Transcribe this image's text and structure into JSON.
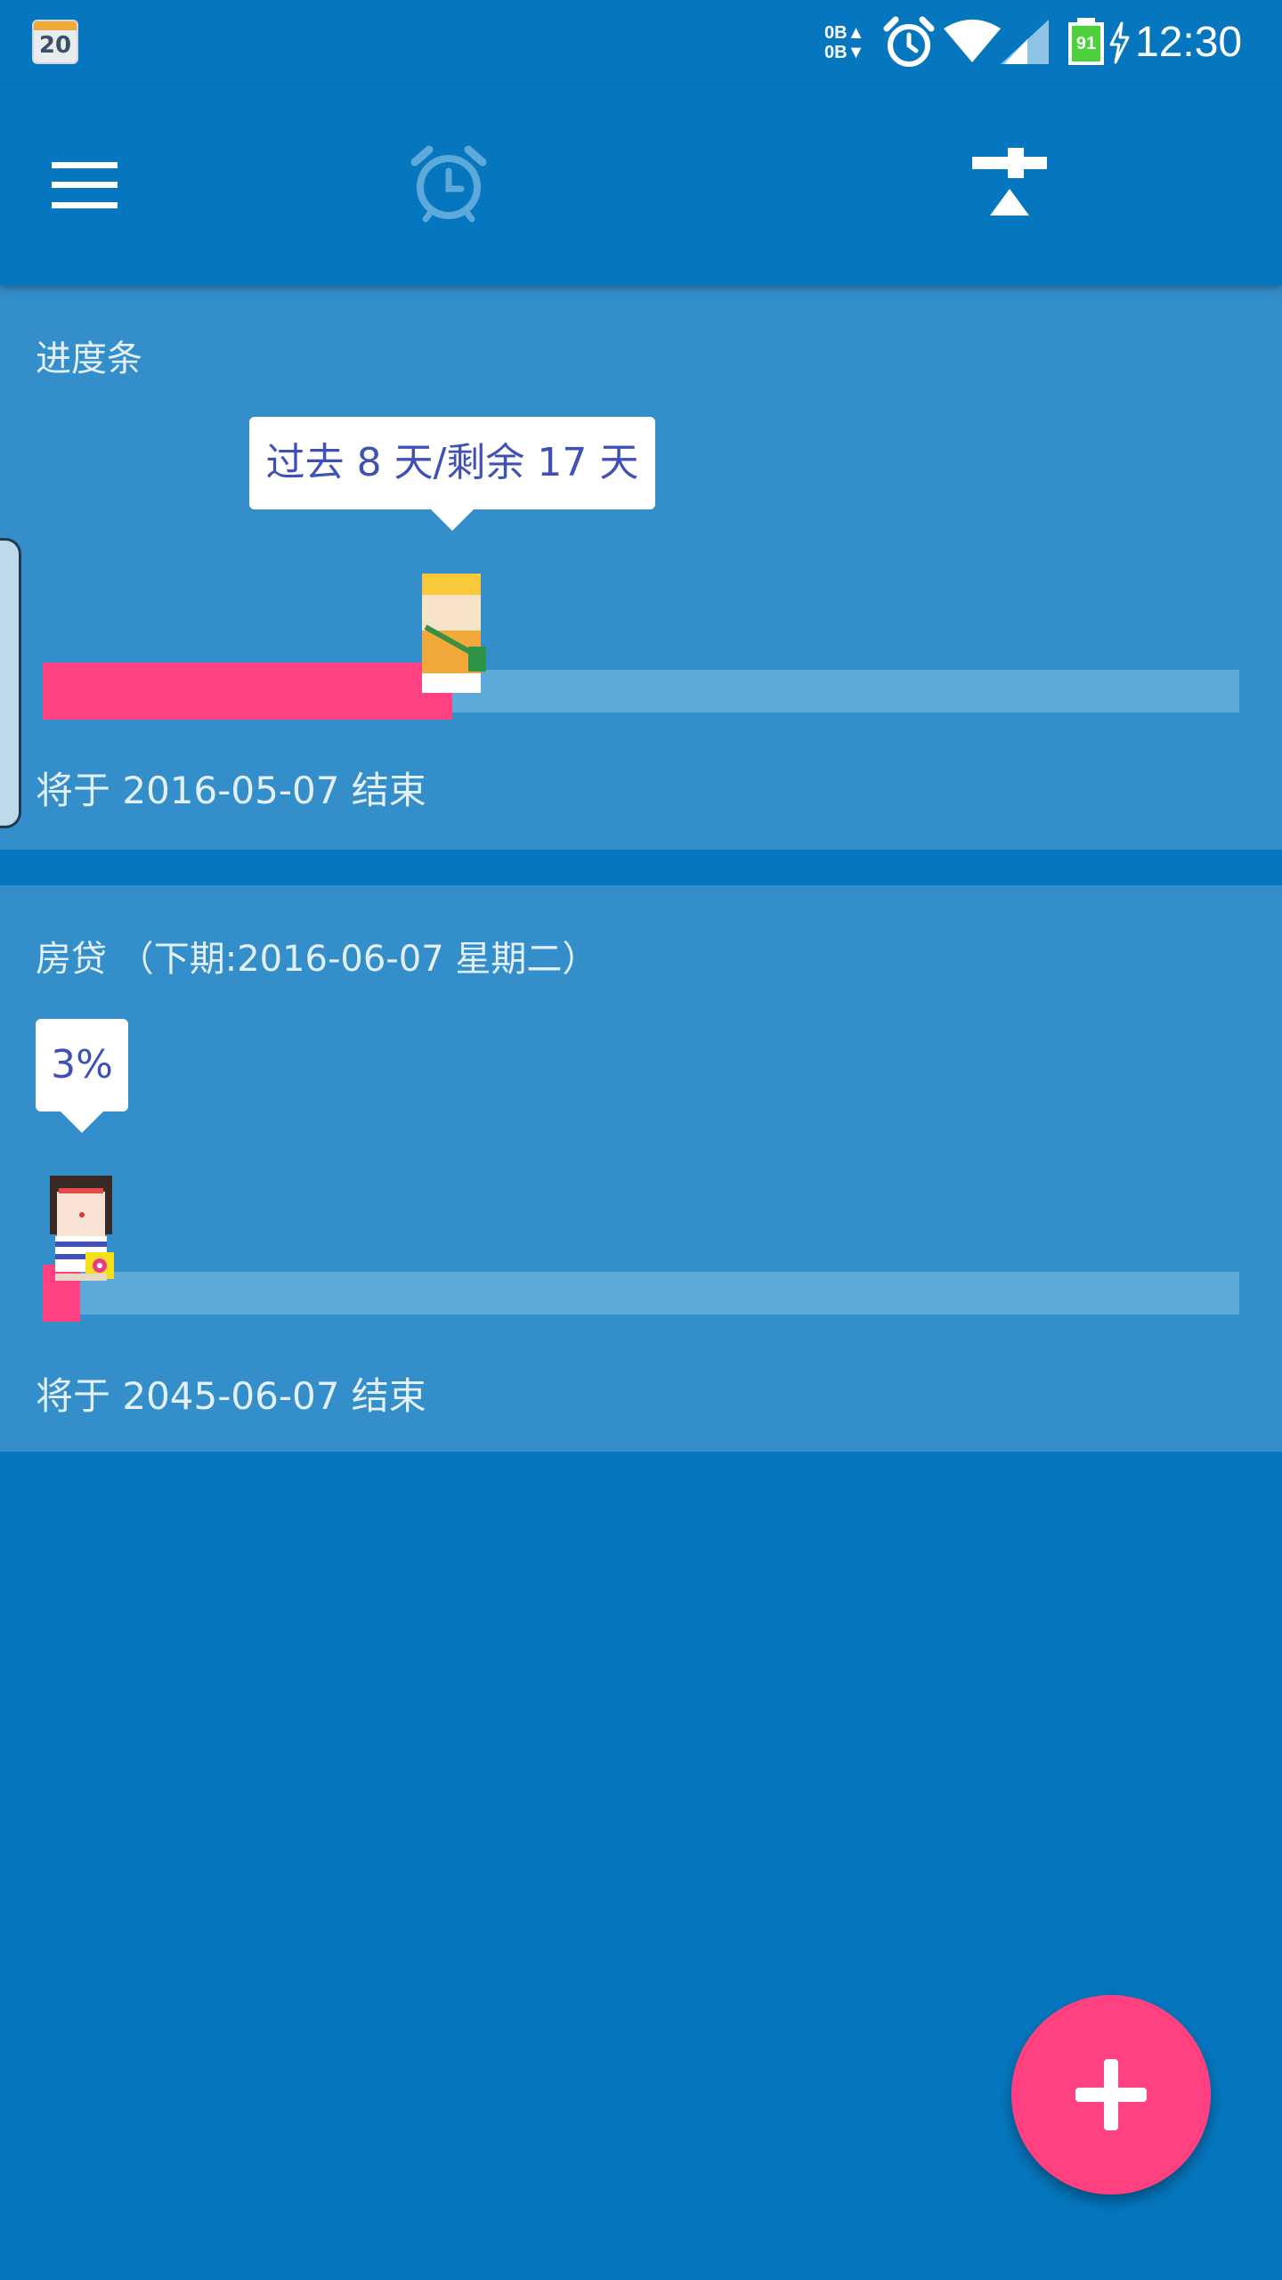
{
  "status_bar": {
    "calendar_day": "20",
    "traffic_up": "0B▲",
    "traffic_down": "0B▼",
    "battery_level": "91",
    "time": "12:30",
    "icons": [
      "calendar-icon",
      "alarm-icon",
      "wifi-icon",
      "signal-icon",
      "battery-icon",
      "charging-icon"
    ]
  },
  "toolbar": {
    "icons": [
      "menu-icon",
      "alarm-clock-icon",
      "sort-filter-icon"
    ]
  },
  "cards": [
    {
      "title": "进度条",
      "tooltip": "过去 8 天/剩余 17 天",
      "progress": 0.32,
      "footer": "将于 2016-05-07 结束"
    },
    {
      "title": "房贷 （下期:2016-06-07 星期二）",
      "tooltip": "3%",
      "progress": 0.03,
      "footer": "将于 2045-06-07 结束"
    }
  ],
  "fab": {
    "icon": "add-icon"
  },
  "colors": {
    "primary": "#0677BF",
    "card": "#338EC9",
    "accent": "#FF4081",
    "track": "#5DA9D9",
    "tooltip_text": "#3F51B5"
  }
}
